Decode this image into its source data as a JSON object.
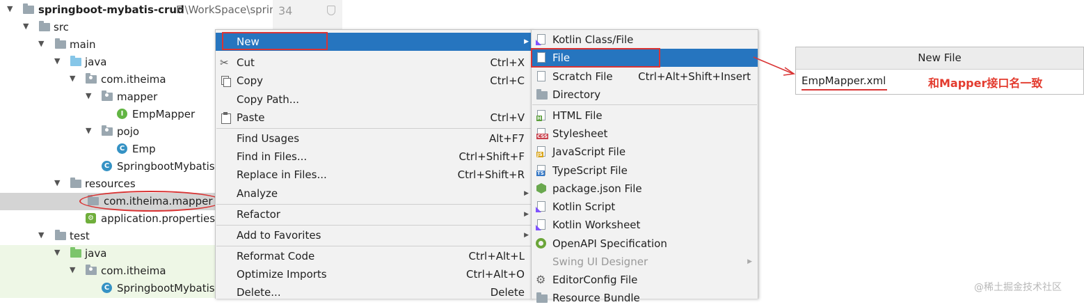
{
  "project_tree": {
    "rows": [
      {
        "label": "springboot-mybatis-crud",
        "path": "F:\\WorkSpace\\spring",
        "icon": "module-folder-icon"
      },
      {
        "label": "src",
        "icon": "folder-icon"
      },
      {
        "label": "main",
        "icon": "folder-icon"
      },
      {
        "label": "java",
        "icon": "source-folder-icon"
      },
      {
        "label": "com.itheima",
        "icon": "package-icon"
      },
      {
        "label": "mapper",
        "icon": "package-icon"
      },
      {
        "label": "EmpMapper",
        "icon": "interface-icon"
      },
      {
        "label": "pojo",
        "icon": "package-icon"
      },
      {
        "label": "Emp",
        "icon": "class-icon"
      },
      {
        "label": "SpringbootMybatis",
        "icon": "spring-class-icon"
      },
      {
        "label": "resources",
        "icon": "resources-folder-icon"
      },
      {
        "label": "com.itheima.mapper",
        "icon": "folder-icon"
      },
      {
        "label": "application.properties",
        "icon": "properties-icon"
      },
      {
        "label": "test",
        "icon": "folder-icon"
      },
      {
        "label": "java",
        "icon": "test-source-folder-icon"
      },
      {
        "label": "com.itheima",
        "icon": "package-icon"
      },
      {
        "label": "SpringbootMybatis",
        "icon": "spring-class-icon"
      }
    ]
  },
  "editor": {
    "line_number": "34"
  },
  "context_menu": {
    "items": [
      {
        "label": "New",
        "shortcut": "",
        "submenu": true,
        "icon": ""
      },
      {
        "label": "Cut",
        "shortcut": "Ctrl+X",
        "icon": "scissors-icon"
      },
      {
        "label": "Copy",
        "shortcut": "Ctrl+C",
        "icon": "copy-icon"
      },
      {
        "label": "Copy Path...",
        "shortcut": "",
        "icon": ""
      },
      {
        "label": "Paste",
        "shortcut": "Ctrl+V",
        "icon": "clipboard-icon"
      },
      {
        "label": "Find Usages",
        "shortcut": "Alt+F7",
        "icon": ""
      },
      {
        "label": "Find in Files...",
        "shortcut": "Ctrl+Shift+F",
        "icon": ""
      },
      {
        "label": "Replace in Files...",
        "shortcut": "Ctrl+Shift+R",
        "icon": ""
      },
      {
        "label": "Analyze",
        "shortcut": "",
        "submenu": true,
        "icon": ""
      },
      {
        "label": "Refactor",
        "shortcut": "",
        "submenu": true,
        "icon": ""
      },
      {
        "label": "Add to Favorites",
        "shortcut": "",
        "submenu": true,
        "icon": ""
      },
      {
        "label": "Reformat Code",
        "shortcut": "Ctrl+Alt+L",
        "icon": ""
      },
      {
        "label": "Optimize Imports",
        "shortcut": "Ctrl+Alt+O",
        "icon": ""
      },
      {
        "label": "Delete...",
        "shortcut": "Delete",
        "icon": ""
      }
    ]
  },
  "new_submenu": {
    "items": [
      {
        "label": "Kotlin Class/File",
        "shortcut": "",
        "icon": "kotlin-icon"
      },
      {
        "label": "File",
        "shortcut": "",
        "icon": "file-icon"
      },
      {
        "label": "Scratch File",
        "shortcut": "Ctrl+Alt+Shift+Insert",
        "icon": "scratch-file-icon"
      },
      {
        "label": "Directory",
        "shortcut": "",
        "icon": "directory-icon"
      },
      {
        "label": "HTML File",
        "shortcut": "",
        "icon": "html-file-icon"
      },
      {
        "label": "Stylesheet",
        "shortcut": "",
        "icon": "css-file-icon"
      },
      {
        "label": "JavaScript File",
        "shortcut": "",
        "icon": "js-file-icon"
      },
      {
        "label": "TypeScript File",
        "shortcut": "",
        "icon": "ts-file-icon"
      },
      {
        "label": "package.json File",
        "shortcut": "",
        "icon": "nodejs-icon"
      },
      {
        "label": "Kotlin Script",
        "shortcut": "",
        "icon": "kotlin-script-icon"
      },
      {
        "label": "Kotlin Worksheet",
        "shortcut": "",
        "icon": "kotlin-worksheet-icon"
      },
      {
        "label": "OpenAPI Specification",
        "shortcut": "",
        "icon": "openapi-icon"
      },
      {
        "label": "Swing UI Designer",
        "shortcut": "",
        "submenu": true,
        "icon": ""
      },
      {
        "label": "EditorConfig File",
        "shortcut": "",
        "icon": "gear-icon"
      },
      {
        "label": "Resource Bundle",
        "shortcut": "",
        "icon": "resource-bundle-icon"
      }
    ]
  },
  "new_file_dialog": {
    "title": "New File",
    "input_value": "EmpMapper.xml",
    "annotation": "和Mapper接口名一致"
  },
  "watermark": "@稀土掘金技术社区",
  "colors": {
    "selection": "#2675bf",
    "annotation_red": "#d93434",
    "menu_bg": "#f2f2f2"
  }
}
